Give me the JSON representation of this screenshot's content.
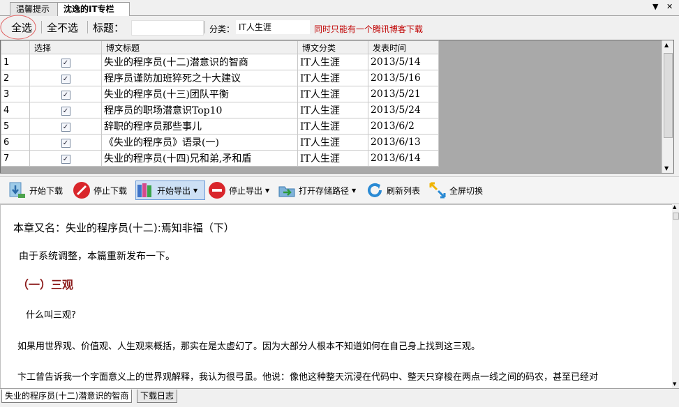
{
  "tabs": [
    {
      "label": "温馨提示"
    },
    {
      "label": "沈逸的IT专栏"
    }
  ],
  "toolbar": {
    "select_all": "全选",
    "select_none": "全不选",
    "title_label": "标题：",
    "title_value": "",
    "category_label": "分类：",
    "category_value": "IT人生涯",
    "note": "同时只能有一个腾讯博客下载"
  },
  "grid": {
    "headers": [
      "选择",
      "博文标题",
      "博文分类",
      "发表时间"
    ],
    "rows": [
      {
        "num": "1",
        "checked": true,
        "title": "失业的程序员(十二)潜意识的智商",
        "category": "IT人生涯",
        "date": "2013/5/14"
      },
      {
        "num": "2",
        "checked": true,
        "title": "程序员谨防加班猝死之十大建议",
        "category": "IT人生涯",
        "date": "2013/5/16"
      },
      {
        "num": "3",
        "checked": true,
        "title": "失业的程序员(十三)团队平衡",
        "category": "IT人生涯",
        "date": "2013/5/21"
      },
      {
        "num": "4",
        "checked": true,
        "title": "程序员的职场潜意识Top10",
        "category": "IT人生涯",
        "date": "2013/5/24"
      },
      {
        "num": "5",
        "checked": true,
        "title": "辞职的程序员那些事儿",
        "category": "IT人生涯",
        "date": "2013/6/2"
      },
      {
        "num": "6",
        "checked": true,
        "title": "《失业的程序员》语录(一)",
        "category": "IT人生涯",
        "date": "2013/6/13"
      },
      {
        "num": "7",
        "checked": true,
        "title": "失业的程序员(十四)兄和弟,矛和盾",
        "category": "IT人生涯",
        "date": "2013/6/14"
      }
    ]
  },
  "actions": {
    "start_download": "开始下载",
    "stop_download": "停止下载",
    "start_export": "开始导出",
    "stop_export": "停止导出",
    "open_path": "打开存储路径",
    "refresh": "刷新列表",
    "fullscreen": "全屏切换"
  },
  "article": {
    "subtitle": "本章又名：失业的程序员(十二):焉知非福（下）",
    "intro": "由于系统调整，本篇重新发布一下。",
    "heading": "（一）三观",
    "q": "什么叫三观?",
    "p1": "如果用世界观、价值观、人生观来概括，那实在是太虚幻了。因为大部分人根本不知道如何在自己身上找到这三观。",
    "p2": "卞工曾告诉我一个字面意义上的世界观解释，我认为很弓虽。他说：像他这种整天沉浸在代码中、整天只穿梭在两点一线之间的码农，甚至已经对"
  },
  "bottom_tabs": [
    {
      "label": "失业的程序员(十二)潜意识的智商"
    },
    {
      "label": "下载日志"
    }
  ],
  "colors": {
    "accent": "#c00000",
    "heading": "#8b1a1a",
    "selected_button_bg": "#cde0f5"
  }
}
